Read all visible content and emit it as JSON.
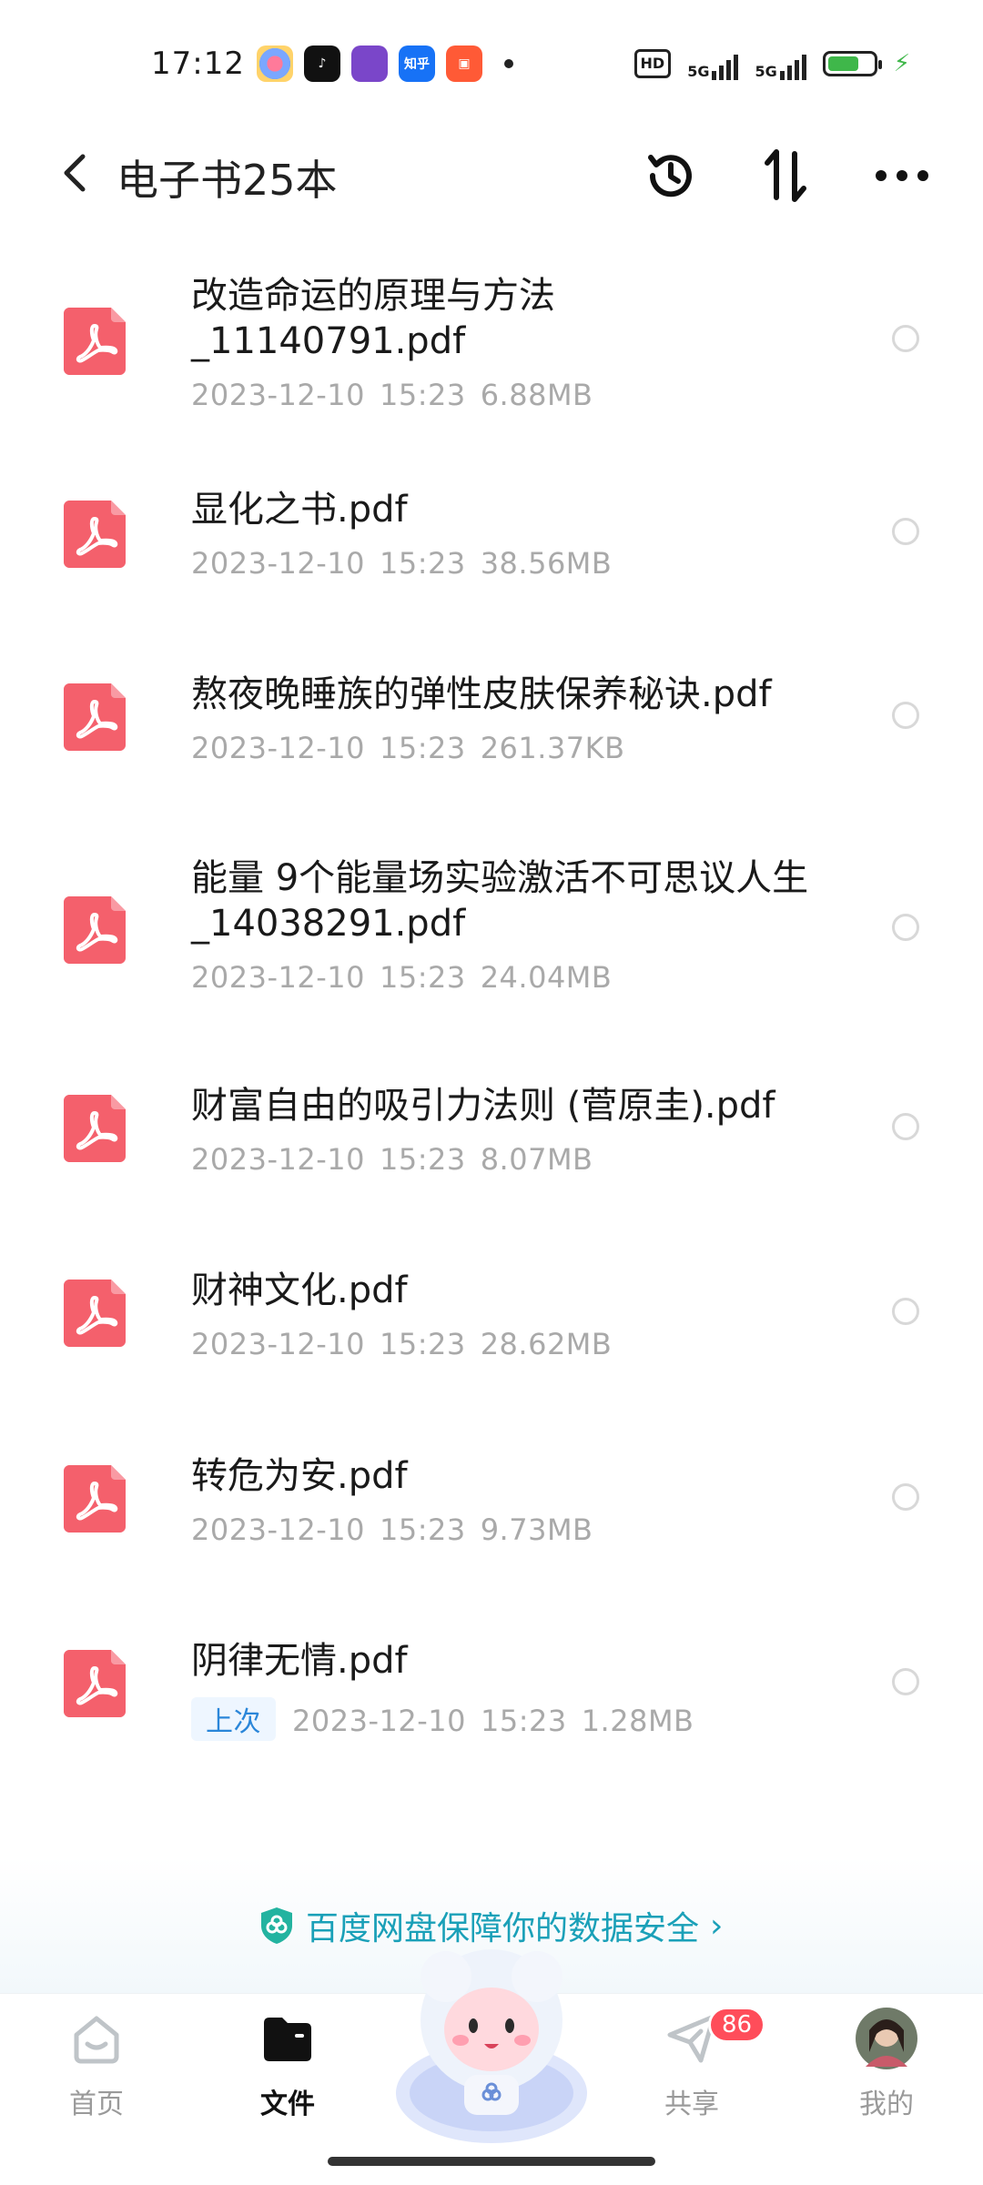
{
  "status": {
    "time": "17:12",
    "apps": [
      {
        "icon": "paint-app-icon",
        "color": "#ffffff",
        "label": ""
      },
      {
        "icon": "tiktok-app-icon",
        "color": "#111111",
        "label": "♪"
      },
      {
        "icon": "game-app-icon",
        "color": "#7a46c9",
        "label": ""
      },
      {
        "icon": "zhihu-app-icon",
        "color": "#1772f6",
        "label": "知乎"
      },
      {
        "icon": "kuaishou-app-icon",
        "color": "#ff5a36",
        "label": "▣"
      }
    ],
    "hd": "HD",
    "net1": "5G",
    "net2": "5G",
    "battery_level": 0.7
  },
  "header": {
    "title": "电子书25本"
  },
  "files": [
    {
      "name": "改造命运的原理与方法_11140791.pdf",
      "date": "2023-12-10",
      "time": "15:23",
      "size": "6.88MB",
      "badge": ""
    },
    {
      "name": "显化之书.pdf",
      "date": "2023-12-10",
      "time": "15:23",
      "size": "38.56MB",
      "badge": ""
    },
    {
      "name": "熬夜晚睡族的弹性皮肤保养秘诀.pdf",
      "date": "2023-12-10",
      "time": "15:23",
      "size": "261.37KB",
      "badge": ""
    },
    {
      "name": "能量 9个能量场实验激活不可思议人生_14038291.pdf",
      "date": "2023-12-10",
      "time": "15:23",
      "size": "24.04MB",
      "badge": ""
    },
    {
      "name": "财富自由的吸引力法则 (菅原圭).pdf",
      "date": "2023-12-10",
      "time": "15:23",
      "size": "8.07MB",
      "badge": ""
    },
    {
      "name": "财神文化.pdf",
      "date": "2023-12-10",
      "time": "15:23",
      "size": "28.62MB",
      "badge": ""
    },
    {
      "name": "转危为安.pdf",
      "date": "2023-12-10",
      "time": "15:23",
      "size": "9.73MB",
      "badge": ""
    },
    {
      "name": "阴律无情.pdf",
      "date": "2023-12-10",
      "time": "15:23",
      "size": "1.28MB",
      "badge": "上次"
    }
  ],
  "security": {
    "text": "百度网盘保障你的数据安全"
  },
  "nav": {
    "home": "首页",
    "files": "文件",
    "share": "共享",
    "share_badge": "86",
    "me": "我的"
  },
  "colors": {
    "pdf_red": "#f4606c",
    "accent": "#1aa0b8",
    "badge_red": "#ff4d5a"
  }
}
